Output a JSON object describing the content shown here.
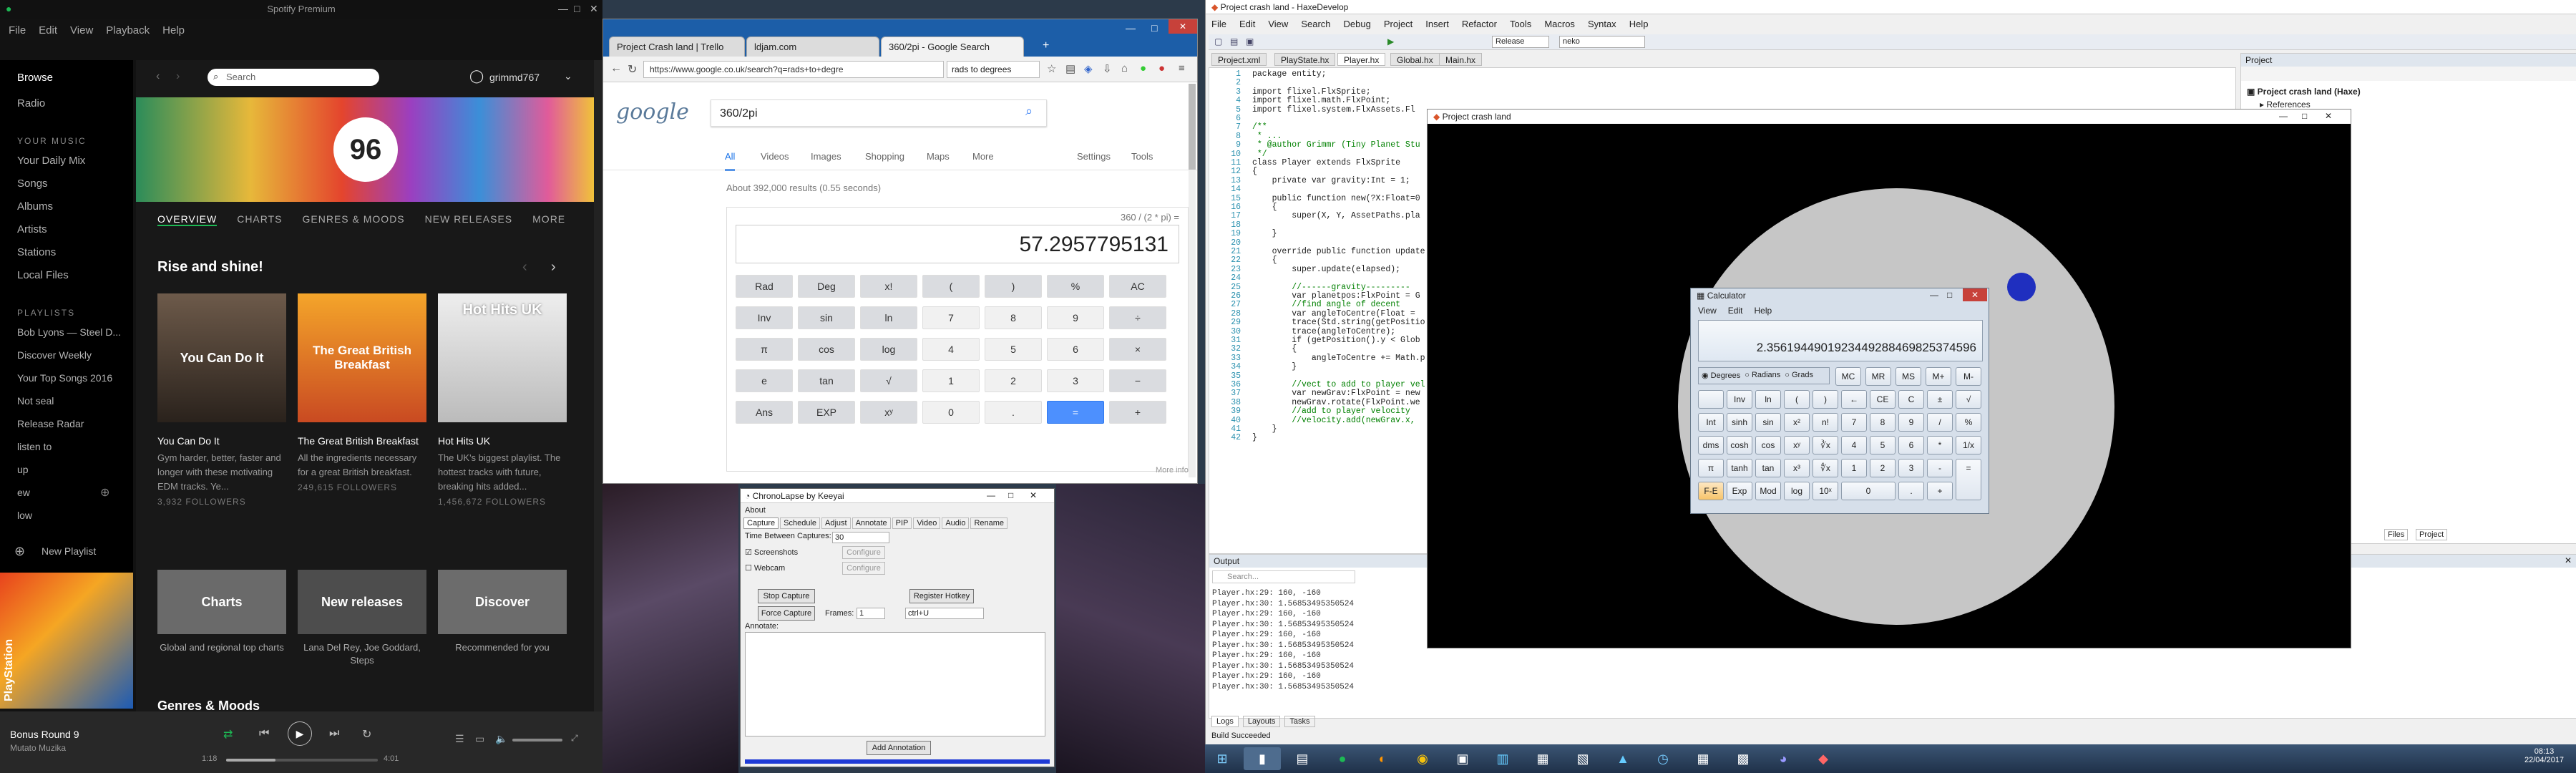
{
  "spotify": {
    "title": "Spotify Premium",
    "menu": [
      "File",
      "Edit",
      "View",
      "Playback",
      "Help"
    ],
    "search_placeholder": "Search",
    "user": "grimmd767",
    "nav": [
      "Browse",
      "Radio"
    ],
    "your_music_header": "YOUR MUSIC",
    "your_music": [
      "Your Daily Mix",
      "Songs",
      "Albums",
      "Artists",
      "Stations",
      "Local Files"
    ],
    "playlists_header": "PLAYLISTS",
    "playlists": [
      "Bob Lyons — Steel D...",
      "Discover Weekly",
      "Your Top Songs 2016",
      "Not seal",
      "Release Radar",
      "listen to",
      "up",
      "ew",
      "low"
    ],
    "new_playlist": "New Playlist",
    "tabs": [
      "OVERVIEW",
      "CHARTS",
      "GENRES & MOODS",
      "NEW RELEASES",
      "MORE"
    ],
    "section_title": "Rise and shine!",
    "cards": [
      {
        "img_text": "You Can Do It",
        "title": "You Can Do It",
        "desc": "Gym harder, better, faster and longer with these motivating EDM tracks. Ye...",
        "followers": "3,932 FOLLOWERS"
      },
      {
        "img_text": "The Great British Breakfast",
        "title": "The Great British Breakfast",
        "desc": "All the ingredients necessary for a great British breakfast.",
        "followers": "249,615 FOLLOWERS"
      },
      {
        "img_text": "Hot Hits UK",
        "title": "Hot Hits UK",
        "desc": "The UK's biggest playlist. The hottest tracks with future, breaking hits added...",
        "followers": "1,456,672 FOLLOWERS"
      }
    ],
    "genre_cards": [
      {
        "label": "Charts",
        "desc": "Global and regional top charts"
      },
      {
        "label": "New releases",
        "desc": "Lana Del Rey, Joe Goddard, Steps"
      },
      {
        "label": "Discover",
        "desc": "Recommended for you"
      }
    ],
    "genres_heading": "Genres & Moods",
    "now_playing_title": "Bonus Round 9",
    "now_playing_artist": "Mutato Muzika",
    "time_elapsed": "1:18",
    "time_total": "4:01",
    "side_label": "PlayStation"
  },
  "chrome": {
    "tabs": [
      "Project Crash land | Trello",
      "ldjam.com",
      "360/2pi - Google Search"
    ],
    "url": "https://www.google.co.uk/search?q=rads+to+degre",
    "search_box": "rads to degrees",
    "query": "360/2pi",
    "search_tabs": [
      "All",
      "Videos",
      "Images",
      "Shopping",
      "Maps",
      "More",
      "Settings",
      "Tools"
    ],
    "results_count": "About 392,000 results (0.55 seconds)",
    "expression": "360 / (2 * pi) =",
    "result": "57.2957795131",
    "keys": [
      [
        "Rad",
        "Deg",
        "x!",
        "(",
        ")",
        "%",
        "AC"
      ],
      [
        "Inv",
        "sin",
        "ln",
        "7",
        "8",
        "9",
        "÷"
      ],
      [
        "π",
        "cos",
        "log",
        "4",
        "5",
        "6",
        "×"
      ],
      [
        "e",
        "tan",
        "√",
        "1",
        "2",
        "3",
        "−"
      ],
      [
        "Ans",
        "EXP",
        "xʸ",
        "0",
        ".",
        "=",
        "+"
      ]
    ],
    "more_info": "More info"
  },
  "chrono": {
    "title": "ChronoLapse by Keeyai",
    "menu": "About",
    "tabs": [
      "Capture",
      "Schedule",
      "Adjust",
      "Annotate",
      "PIP",
      "Video",
      "Audio",
      "Rename"
    ],
    "time_between": "Time Between Captures:",
    "time_value": "30",
    "cb_screenshots": "Screenshots",
    "cb_webcam": "Webcam",
    "configure": "Configure",
    "stop_capture": "Stop Capture",
    "force_capture": "Force Capture",
    "frames_label": "Frames:",
    "frames_value": "1",
    "register_hotkey": "Register Hotkey",
    "hotkey": "ctrl+U",
    "annotate_label": "Annotate:",
    "add_annotation": "Add Annotation"
  },
  "haxe": {
    "title": "Project crash land - HaxeDevelop",
    "menu": [
      "File",
      "Edit",
      "View",
      "Search",
      "Debug",
      "Project",
      "Insert",
      "Refactor",
      "Tools",
      "Macros",
      "Syntax",
      "Help"
    ],
    "build_config": "Release",
    "target": "neko",
    "file_tabs": [
      "Project.xml",
      "PlayState.hx",
      "Player.hx",
      "Global.hx",
      "Main.hx"
    ],
    "code": [
      {
        "n": "1",
        "t": "package entity;"
      },
      {
        "n": "2",
        "t": ""
      },
      {
        "n": "3",
        "t": "import flixel.FlxSprite;"
      },
      {
        "n": "4",
        "t": "import flixel.math.FlxPoint;"
      },
      {
        "n": "5",
        "t": "import flixel.system.FlxAssets.Fl"
      },
      {
        "n": "6",
        "t": ""
      },
      {
        "n": "7",
        "t": "/**"
      },
      {
        "n": "8",
        "t": " * ..."
      },
      {
        "n": "9",
        "t": " * @author Grimmr (Tiny Planet Stu"
      },
      {
        "n": "10",
        "t": " */"
      },
      {
        "n": "11",
        "t": "class Player extends FlxSprite"
      },
      {
        "n": "12",
        "t": "{"
      },
      {
        "n": "13",
        "t": "    private var gravity:Int = 1;"
      },
      {
        "n": "14",
        "t": ""
      },
      {
        "n": "15",
        "t": "    public function new(?X:Float=0"
      },
      {
        "n": "16",
        "t": "    {"
      },
      {
        "n": "17",
        "t": "        super(X, Y, AssetPaths.pla"
      },
      {
        "n": "18",
        "t": ""
      },
      {
        "n": "19",
        "t": "    }"
      },
      {
        "n": "20",
        "t": ""
      },
      {
        "n": "21",
        "t": "    override public function update"
      },
      {
        "n": "22",
        "t": "    {"
      },
      {
        "n": "23",
        "t": "        super.update(elapsed);"
      },
      {
        "n": "24",
        "t": ""
      },
      {
        "n": "25",
        "t": "        //------gravity---------"
      },
      {
        "n": "26",
        "t": "        var planetpos:FlxPoint = G"
      },
      {
        "n": "27",
        "t": "        //find angle of decent"
      },
      {
        "n": "28",
        "t": "        var angleToCentre(Float ="
      },
      {
        "n": "29",
        "t": "        trace(Std.string(getPositio"
      },
      {
        "n": "30",
        "t": "        trace(angleToCentre);"
      },
      {
        "n": "31",
        "t": "        if (getPosition().y < Glob"
      },
      {
        "n": "32",
        "t": "        {"
      },
      {
        "n": "33",
        "t": "            angleToCentre += Math.p"
      },
      {
        "n": "34",
        "t": "        }"
      },
      {
        "n": "35",
        "t": ""
      },
      {
        "n": "36",
        "t": "        //vect to add to player vel"
      },
      {
        "n": "37",
        "t": "        var newGrav:FlxPoint = new"
      },
      {
        "n": "38",
        "t": "        newGrav.rotate(FlxPoint.we"
      },
      {
        "n": "39",
        "t": "        //add to player velocity"
      },
      {
        "n": "40",
        "t": "        //velocity.add(newGrav.x,"
      },
      {
        "n": "41",
        "t": "    }"
      },
      {
        "n": "42",
        "t": "}"
      }
    ],
    "project_title": "Project",
    "project_root": "Project crash land (Haxe)",
    "project_ref": "References",
    "output_title": "Output",
    "output_search": "Search...",
    "output_lines": [
      "Player.hx:29: 160, -160",
      "Player.hx:30: 1.56853495350524",
      "Player.hx:29: 160, -160",
      "Player.hx:30: 1.56853495350524",
      "Player.hx:29: 160, -160",
      "Player.hx:30: 1.56853495350524",
      "Player.hx:29: 160, -160",
      "Player.hx:30: 1.56853495350524",
      "Player.hx:29: 160, -160",
      "Player.hx:30: 1.56853495350524"
    ],
    "bottom_tabs": [
      "Logs",
      "Layouts",
      "Tasks"
    ],
    "status": "Build Succeeded",
    "right_tabs": [
      "Files",
      "Project"
    ]
  },
  "game": {
    "title": "Project crash land"
  },
  "wcalc": {
    "title": "Calculator",
    "menu": [
      "View",
      "Edit",
      "Help"
    ],
    "display": "2.3561944901923449288469825374596",
    "modes": [
      "Degrees",
      "Radians",
      "Grads"
    ],
    "mem": [
      "MC",
      "MR",
      "MS",
      "M+",
      "M-"
    ],
    "rows": [
      [
        "",
        "Inv",
        "ln",
        "(",
        ")",
        "←",
        "CE",
        "C",
        "±",
        "√"
      ],
      [
        "Int",
        "sinh",
        "sin",
        "x²",
        "n!",
        "7",
        "8",
        "9",
        "/",
        "%"
      ],
      [
        "dms",
        "cosh",
        "cos",
        "xʸ",
        "∛x",
        "4",
        "5",
        "6",
        "*",
        "1/x"
      ],
      [
        "π",
        "tanh",
        "tan",
        "x³",
        "∜x",
        "1",
        "2",
        "3",
        "-",
        "="
      ],
      [
        "F-E",
        "Exp",
        "Mod",
        "log",
        "10ˣ",
        "0",
        "",
        ".",
        "+",
        ""
      ]
    ]
  },
  "taskbar": {
    "time": "08:13",
    "date": "22/04/2017"
  }
}
